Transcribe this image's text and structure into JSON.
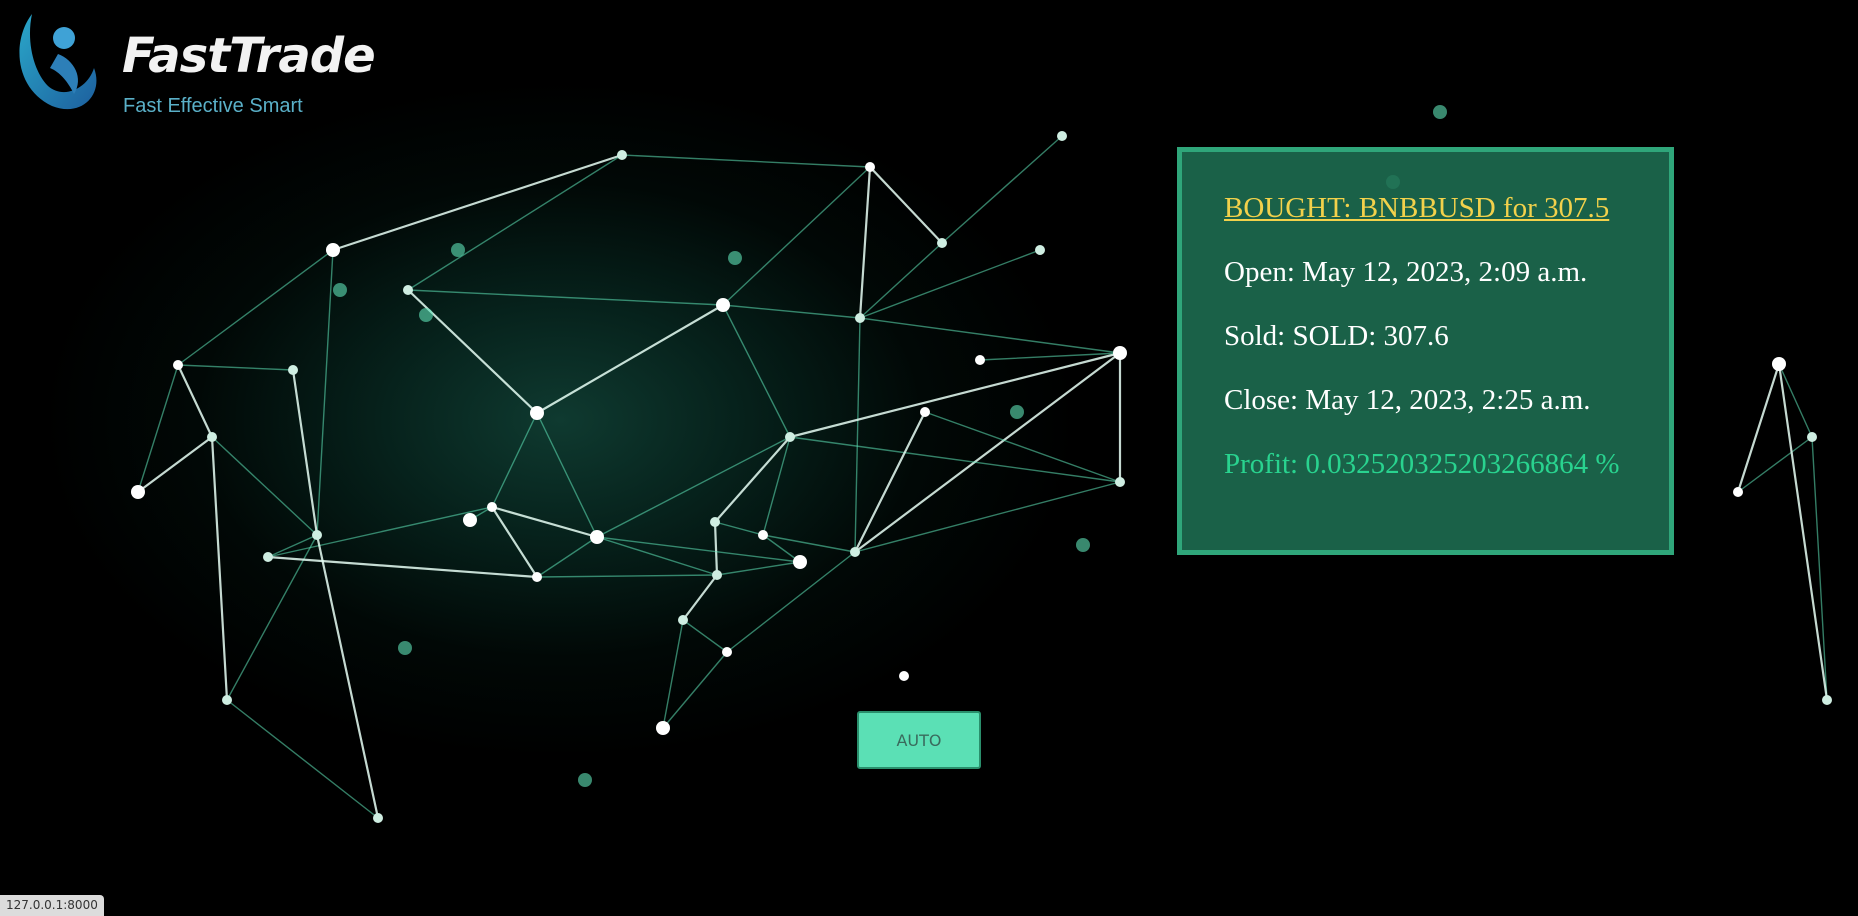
{
  "brand": {
    "title": "FastTrade",
    "tagline": "Fast Effective Smart"
  },
  "trade": {
    "bought": "BOUGHT: BNBBUSD for 307.5",
    "open": "Open: May 12, 2023, 2:09 a.m.",
    "sold": "Sold: SOLD: 307.6",
    "close": "Close: May 12, 2023, 2:25 a.m.",
    "profit": "Profit: 0.032520325203266864 %"
  },
  "controls": {
    "auto_label": "AUTO"
  },
  "status_bar": {
    "url": "127.0.0.1:8000"
  },
  "colors": {
    "card_bg": "#1e6e52",
    "card_border": "#2fa67a",
    "bought_link": "#f2d14b",
    "profit": "#29d38f",
    "auto_button": "#5be0b5",
    "network_line": "#5fe3b8"
  }
}
